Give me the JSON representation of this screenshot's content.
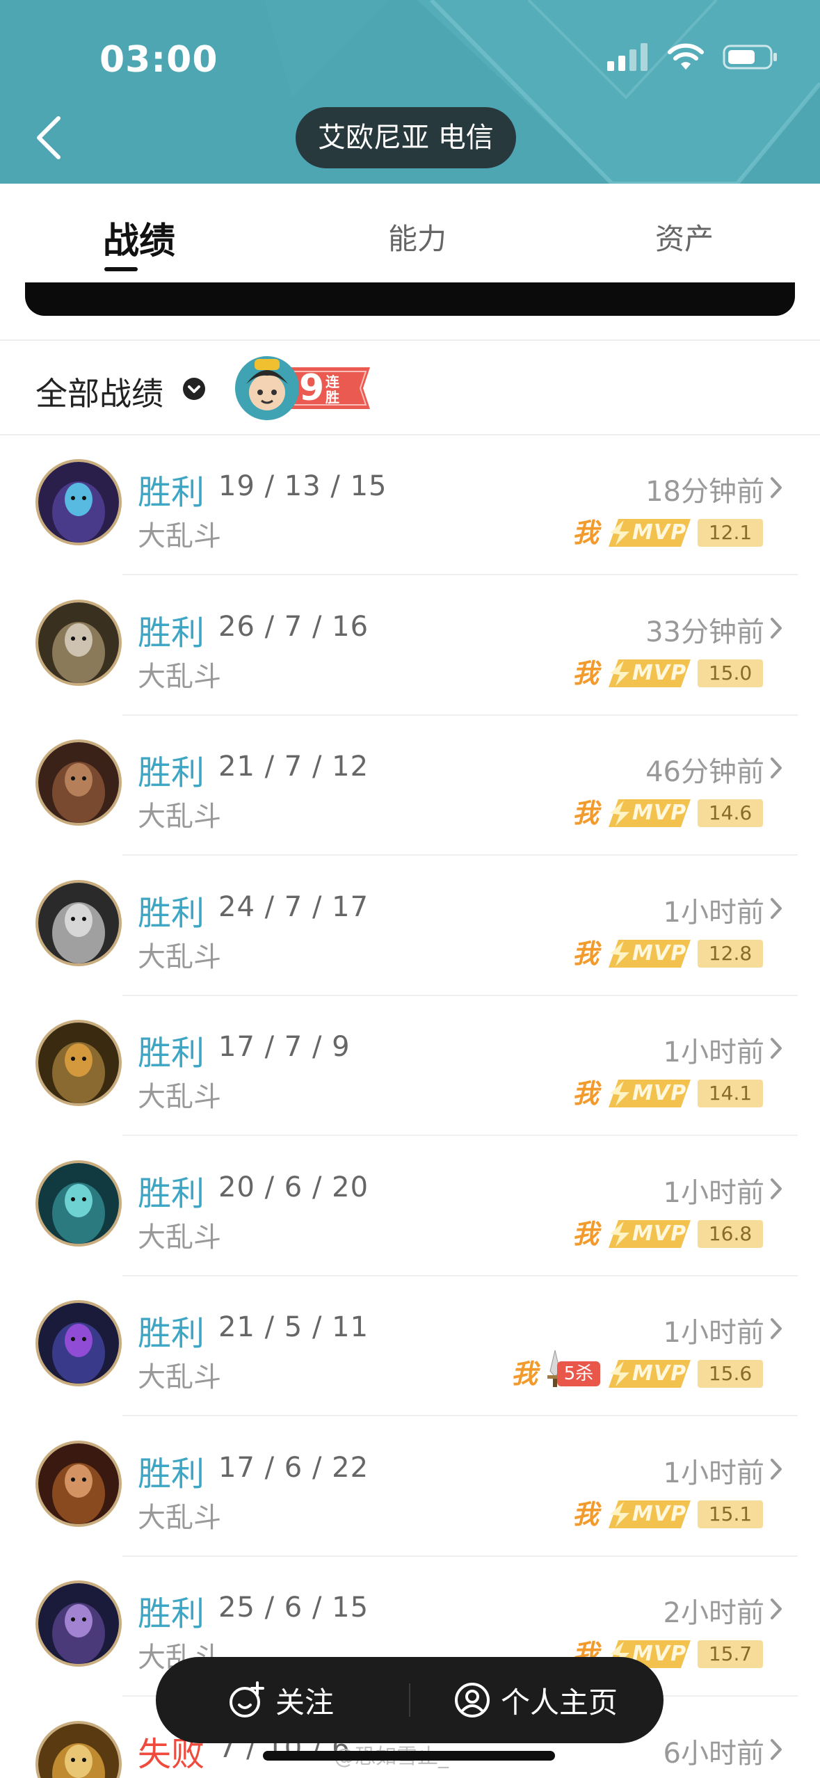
{
  "status_bar": {
    "time": "03:00"
  },
  "header": {
    "server": "艾欧尼亚 电信"
  },
  "tabs": [
    {
      "label": "战绩",
      "active": true
    },
    {
      "label": "能力",
      "active": false
    },
    {
      "label": "资产",
      "active": false
    }
  ],
  "filter": {
    "label": "全部战绩",
    "streak_number": "9",
    "streak_text": "连胜"
  },
  "matches": [
    {
      "result": "胜利",
      "kda": "19 / 13 / 15",
      "mode": "大乱斗",
      "time": "18分钟前",
      "score": "12.1",
      "penta": false
    },
    {
      "result": "胜利",
      "kda": "26 / 7 / 16",
      "mode": "大乱斗",
      "time": "33分钟前",
      "score": "15.0",
      "penta": false
    },
    {
      "result": "胜利",
      "kda": "21 / 7 / 12",
      "mode": "大乱斗",
      "time": "46分钟前",
      "score": "14.6",
      "penta": false
    },
    {
      "result": "胜利",
      "kda": "24 / 7 / 17",
      "mode": "大乱斗",
      "time": "1小时前",
      "score": "12.8",
      "penta": false
    },
    {
      "result": "胜利",
      "kda": "17 / 7 / 9",
      "mode": "大乱斗",
      "time": "1小时前",
      "score": "14.1",
      "penta": false
    },
    {
      "result": "胜利",
      "kda": "20 / 6 / 20",
      "mode": "大乱斗",
      "time": "1小时前",
      "score": "16.8",
      "penta": false
    },
    {
      "result": "胜利",
      "kda": "21 / 5 / 11",
      "mode": "大乱斗",
      "time": "1小时前",
      "score": "15.6",
      "penta": true
    },
    {
      "result": "胜利",
      "kda": "17 / 6 / 22",
      "mode": "大乱斗",
      "time": "1小时前",
      "score": "15.1",
      "penta": false
    },
    {
      "result": "胜利",
      "kda": "25 / 6 / 15",
      "mode": "大乱斗",
      "time": "2小时前",
      "score": "15.7",
      "penta": false
    },
    {
      "result": "失败",
      "kda": "7 / 10 / 6",
      "mode": "大乱斗",
      "time": "6小时前",
      "score": "",
      "penta": false
    }
  ],
  "badges": {
    "me": "我",
    "mvp": "MVP",
    "penta": "5杀"
  },
  "float_bar": {
    "follow": "关注",
    "profile": "个人主页"
  },
  "watermark": "@恐如雪止_",
  "colors": {
    "header": "#4ea6b3",
    "win": "#3ca6c4",
    "loss": "#f04a3c",
    "mvp_gold": "#f2c14e",
    "me_orange": "#f29b2c"
  },
  "icons": [
    "back-chevron-icon",
    "signal-icon",
    "wifi-icon",
    "battery-icon",
    "chevron-down-icon",
    "chevron-right-icon",
    "follow-icon",
    "profile-icon",
    "sword-icon"
  ]
}
